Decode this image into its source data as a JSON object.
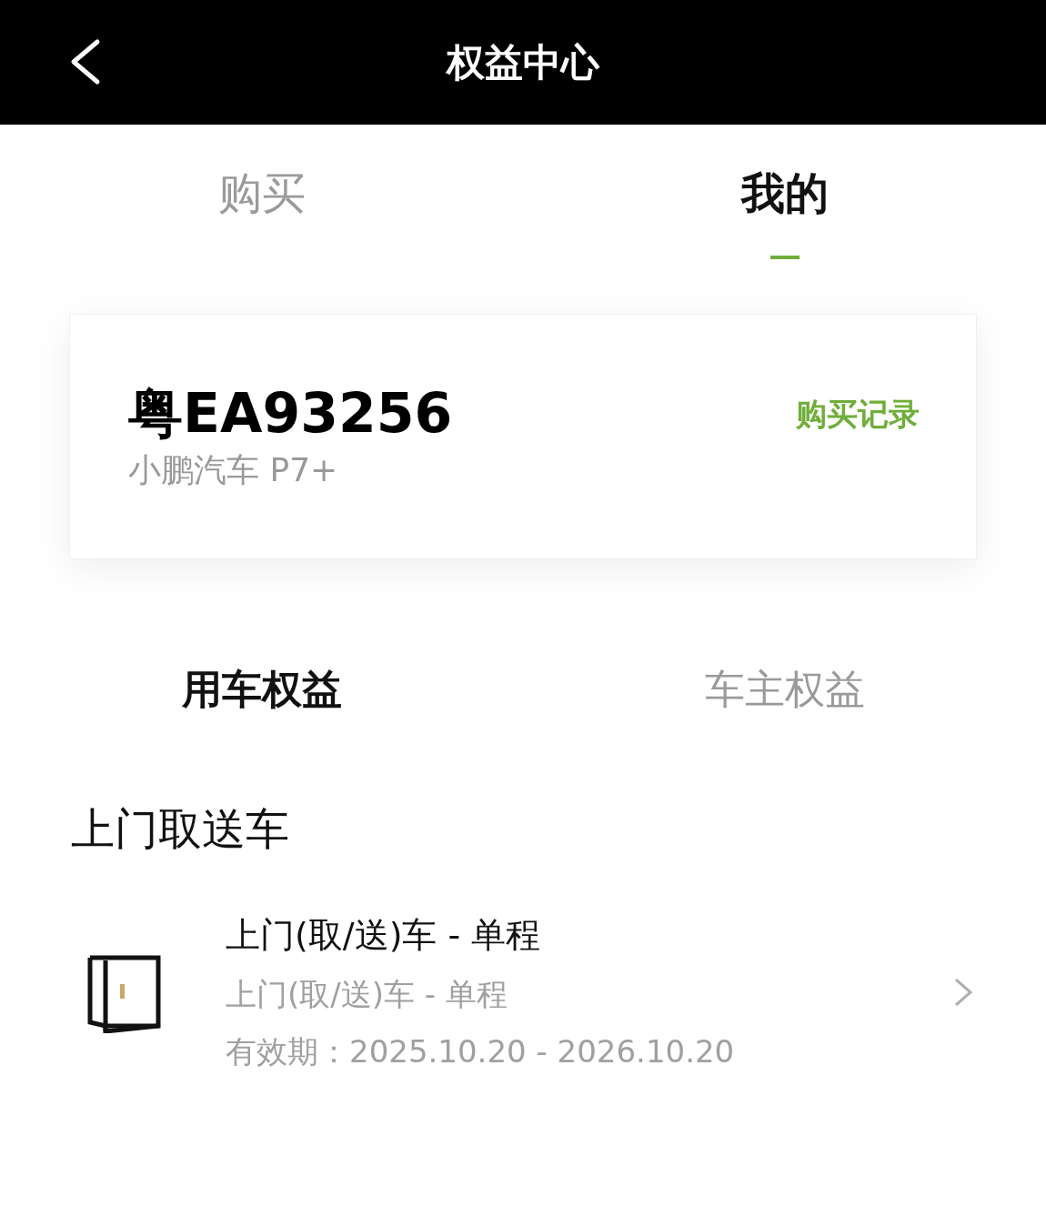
{
  "header": {
    "title": "权益中心"
  },
  "tabs": [
    {
      "label": "购买",
      "selected": false
    },
    {
      "label": "我的",
      "selected": true
    }
  ],
  "vehicle": {
    "plate": "粤EA93256",
    "model": "小鹏汽车 P7+",
    "link": "购买记录"
  },
  "benefit_tabs": [
    {
      "label": "用车权益",
      "selected": true
    },
    {
      "label": "车主权益",
      "selected": false
    }
  ],
  "section": {
    "title": "上门取送车",
    "items": [
      {
        "title": "上门(取/送)车 - 单程",
        "subtitle": "上门(取/送)车 - 单程",
        "validity": "有效期：2025.10.20 - 2026.10.20"
      }
    ]
  }
}
